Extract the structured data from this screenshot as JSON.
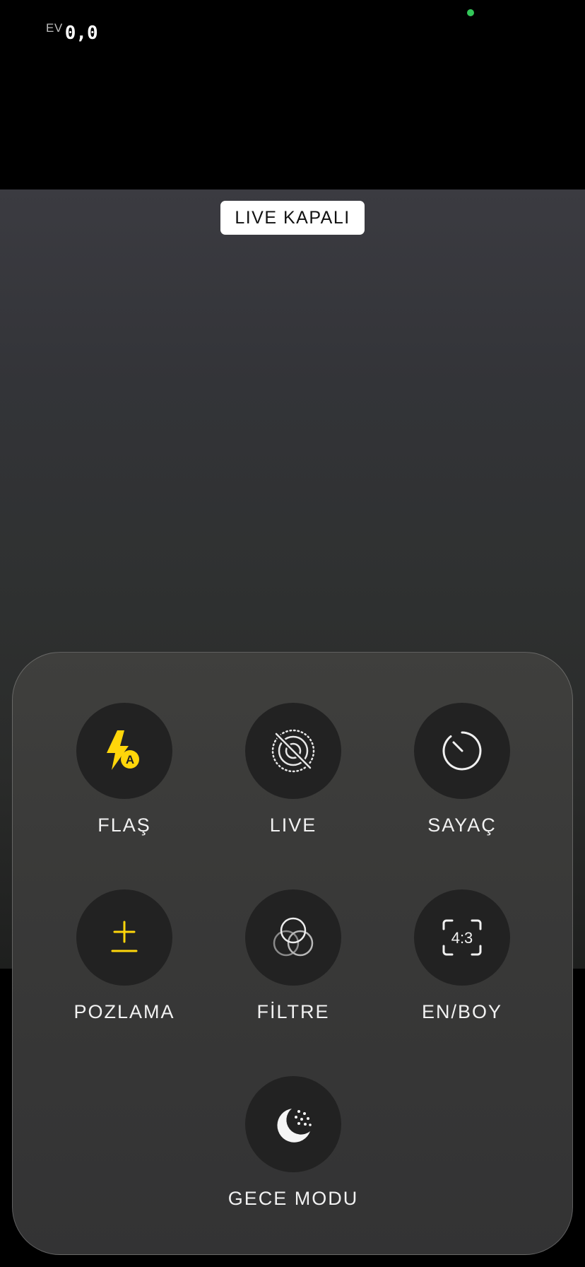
{
  "status": {
    "ev_label": "EV",
    "ev_value": "0,0"
  },
  "viewfinder": {
    "live_badge": "LIVE KAPALI"
  },
  "controls": {
    "flash": {
      "label": "FLAŞ",
      "icon": "flash-auto-icon",
      "badge": "A"
    },
    "live": {
      "label": "LIVE",
      "icon": "live-photo-off-icon"
    },
    "timer": {
      "label": "SAYAÇ",
      "icon": "timer-icon"
    },
    "exposure": {
      "label": "POZLAMA",
      "icon": "exposure-plus-minus-icon"
    },
    "filter": {
      "label": "FİLTRE",
      "icon": "filter-circles-icon"
    },
    "aspect": {
      "label": "EN/BOY",
      "icon": "aspect-ratio-icon",
      "value": "4:3"
    },
    "night": {
      "label": "GECE MODU",
      "icon": "night-mode-moon-icon"
    }
  },
  "colors": {
    "accent_yellow": "#FFD60A",
    "privacy_dot_green": "#33C759"
  }
}
